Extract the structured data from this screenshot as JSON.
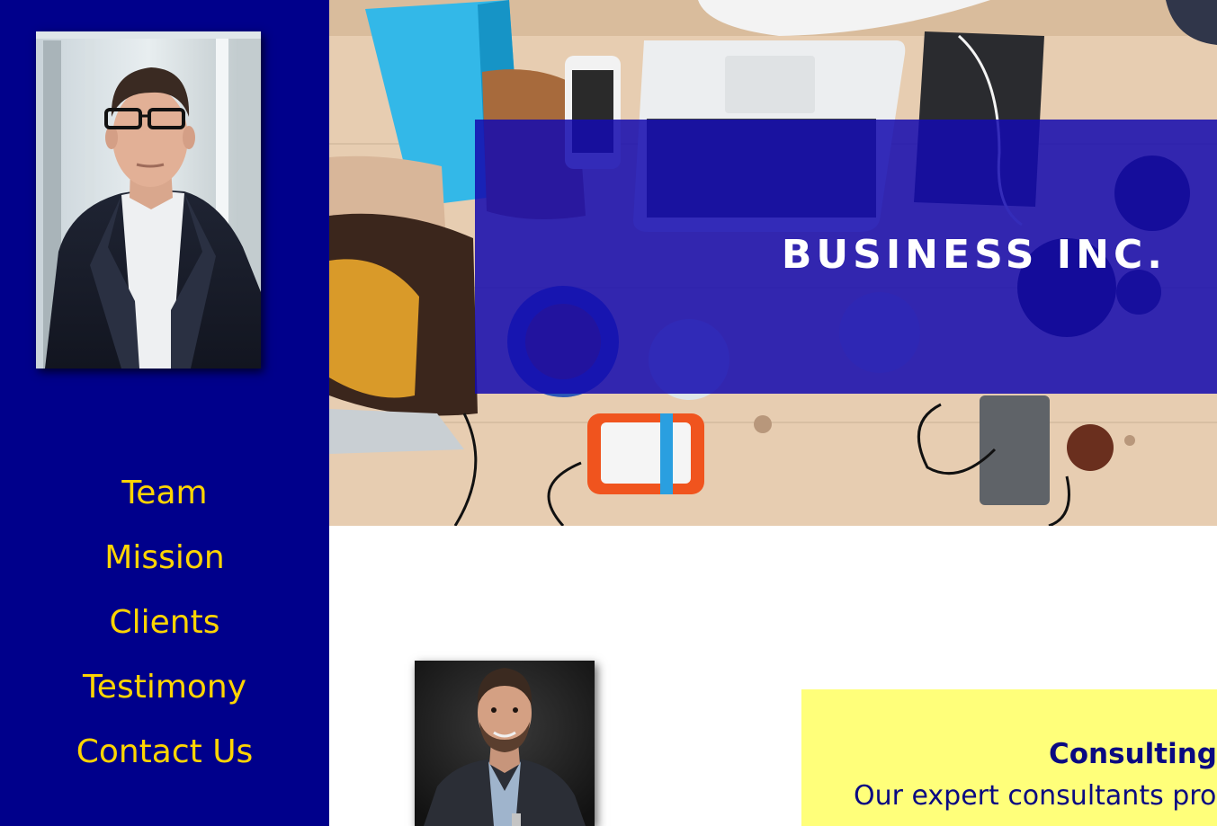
{
  "sidebar": {
    "profile_photo_alt": "Team member portrait",
    "nav": [
      {
        "label": "Team"
      },
      {
        "label": "Mission"
      },
      {
        "label": "Clients"
      },
      {
        "label": "Testimony"
      },
      {
        "label": "Contact Us"
      }
    ]
  },
  "hero": {
    "title": "BUSINESS INC."
  },
  "content": {
    "service": {
      "title": "Consulting S",
      "text": "Our expert consultants prov"
    }
  },
  "colors": {
    "sidebar_bg": "#00008b",
    "nav_text": "#ffd500",
    "hero_banner": "#140aaf",
    "card_bg": "#ffff7a",
    "card_text": "#0a0a82"
  }
}
